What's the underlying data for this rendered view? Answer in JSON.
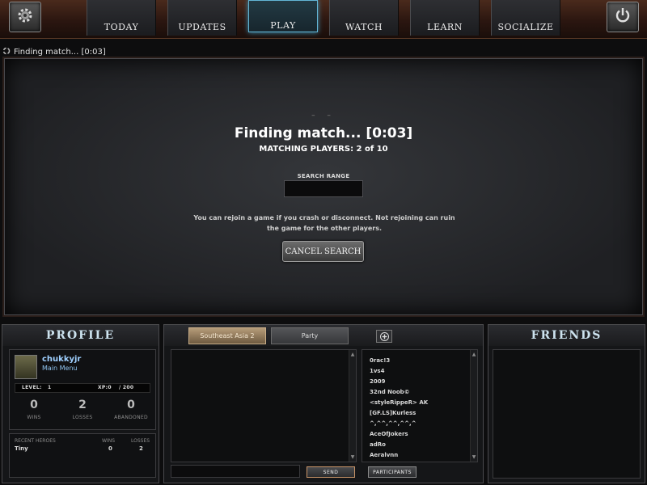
{
  "nav": {
    "tabs": [
      {
        "label": "TODAY",
        "active": false
      },
      {
        "label": "UPDATES",
        "active": false
      },
      {
        "label": "PLAY",
        "active": true
      },
      {
        "label": "WATCH",
        "active": false
      },
      {
        "label": "LEARN",
        "active": false
      },
      {
        "label": "SOCIALIZE",
        "active": false
      }
    ],
    "settings_icon": "gear-icon",
    "power_icon": "power-icon"
  },
  "status": {
    "text": "Finding match... [0:03]"
  },
  "match": {
    "title": "Finding match... [0:03]",
    "players": "MATCHING PLAYERS: 2 of 10",
    "search_range_label": "SEARCH RANGE",
    "rejoin_note": "You can rejoin a game if you crash or disconnect. Not rejoining can ruin the game for the other players.",
    "cancel_label": "CANCEL SEARCH"
  },
  "profile": {
    "header": "PROFILE",
    "name": "chukkyjr",
    "subtitle": "Main Menu",
    "level_label": "LEVEL:",
    "level_value": "1",
    "xp_label": "XP:0",
    "xp_total": "/ 200",
    "stats": [
      {
        "value": "0",
        "label": "WINS"
      },
      {
        "value": "2",
        "label": "LOSSES"
      },
      {
        "value": "0",
        "label": "ABANDONED"
      }
    ],
    "recent": {
      "header": "RECENT HEROES",
      "wins_header": "WINS",
      "losses_header": "LOSSES",
      "hero": "Tiny",
      "wins": "0",
      "losses": "2"
    }
  },
  "chat": {
    "tabs": [
      {
        "label": "Southeast Asia 2",
        "active": true
      },
      {
        "label": "Party",
        "active": false
      }
    ],
    "participants": [
      "0rac!3",
      "1vs4",
      "2009",
      "32nd Noob©",
      "<styleRippeR> AK",
      "[GF.LS]Kurless",
      "^,^^,^^,^^,^",
      "AceOfJokers",
      "adRo",
      "Aeralvnn"
    ],
    "send_label": "SEND",
    "participants_label": "PARTICIPANTS"
  },
  "friends": {
    "header": "FRIENDS"
  }
}
